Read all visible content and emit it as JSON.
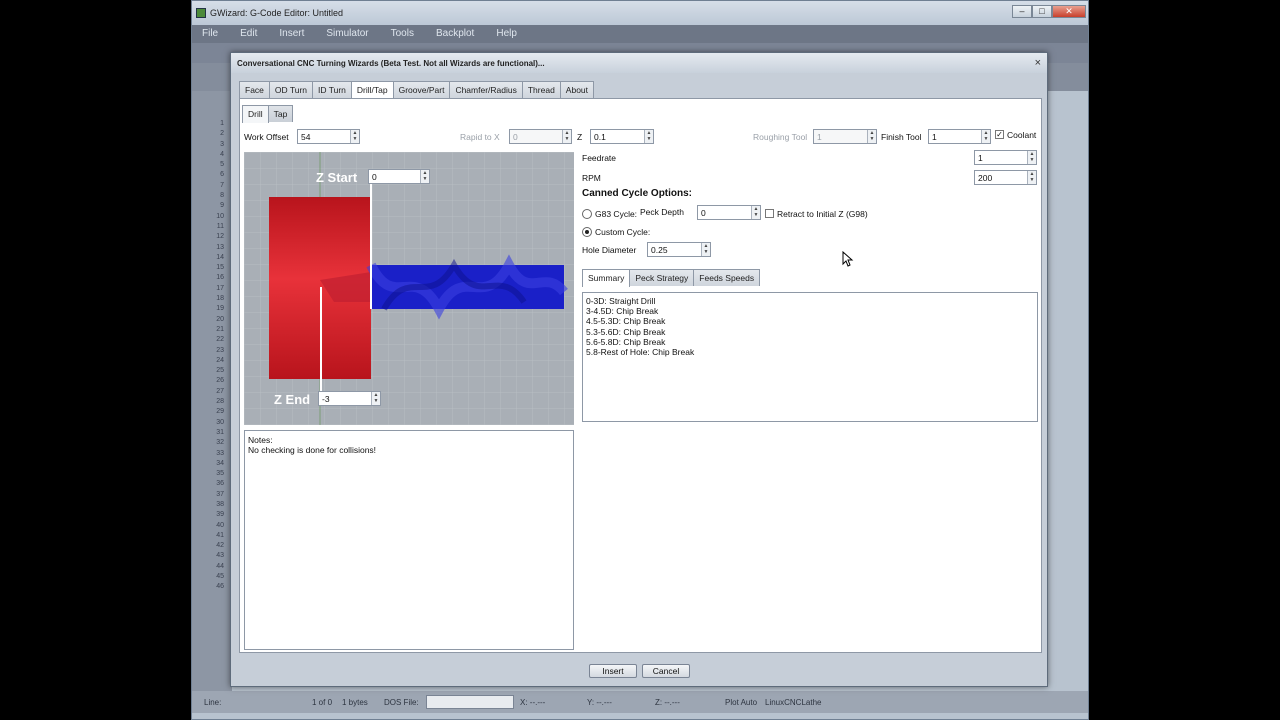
{
  "main_window": {
    "title": "GWizard: G-Code Editor: Untitled",
    "menu": [
      "File",
      "Edit",
      "Insert",
      "Simulator",
      "Tools",
      "Backplot",
      "Help"
    ],
    "line_numbers": [
      "1",
      "2",
      "3",
      "4",
      "5",
      "6",
      "7",
      "8",
      "9",
      "10",
      "11",
      "12",
      "13",
      "14",
      "15",
      "16",
      "17",
      "18",
      "19",
      "20",
      "21",
      "22",
      "23",
      "24",
      "25",
      "26",
      "27",
      "28",
      "29",
      "30",
      "31",
      "32",
      "33",
      "34",
      "35",
      "36",
      "37",
      "38",
      "39",
      "40",
      "41",
      "42",
      "43",
      "44",
      "45",
      "46"
    ],
    "status": {
      "line_label": "Line:",
      "count": "1 of 0",
      "bytes": "1 bytes",
      "dos_file_label": "DOS File:",
      "x": "X: --.---",
      "y": "Y: --.---",
      "z": "Z: --.---",
      "plot": "Plot Auto",
      "machine": "LinuxCNCLathe"
    }
  },
  "dialog": {
    "title": "Conversational CNC Turning Wizards (Beta Test.  Not all Wizards are functional)...",
    "close": "×",
    "tabs": [
      "Face",
      "OD Turn",
      "ID Turn",
      "Drill/Tap",
      "Groove/Part",
      "Chamfer/Radius",
      "Thread",
      "About"
    ],
    "active_tab": "Drill/Tap",
    "subtabs": [
      "Drill",
      "Tap"
    ],
    "active_subtab": "Drill",
    "fields": {
      "work_offset_label": "Work Offset",
      "work_offset": "54",
      "rapid_to_x_label": "Rapid to X",
      "rapid_to_x": "0",
      "z_label": "Z",
      "z": "0.1",
      "roughing_tool_label": "Roughing Tool",
      "roughing_tool": "1",
      "finish_tool_label": "Finish Tool",
      "finish_tool": "1",
      "coolant_label": "Coolant",
      "coolant_checked": true,
      "feedrate_label": "Feedrate",
      "feedrate": "1",
      "rpm_label": "RPM",
      "rpm": "200"
    },
    "canned": {
      "heading": "Canned Cycle Options:",
      "g83_label": "G83 Cycle:",
      "peck_depth_label": "Peck Depth",
      "peck_depth": "0",
      "retract_label": "Retract to Initial Z (G98)",
      "custom_label": "Custom Cycle:",
      "selected": "custom",
      "hole_diameter_label": "Hole Diameter",
      "hole_diameter": "0.25"
    },
    "diagram": {
      "z_start_label": "Z Start",
      "z_start": "0",
      "z_end_label": "Z End",
      "z_end": "-3",
      "colors": {
        "stock": "#d8202a",
        "drill": "#1a1fcc",
        "background": "#a9afb6"
      }
    },
    "notes": [
      "Notes:",
      "No checking is done for collisions!"
    ],
    "result_tabs": [
      "Summary",
      "Peck Strategy",
      "Feeds Speeds"
    ],
    "active_result_tab": "Summary",
    "summary_lines": [
      "0-3D: Straight Drill",
      "3-4.5D: Chip Break",
      "4.5-5.3D: Chip Break",
      "5.3-5.6D: Chip Break",
      "5.6-5.8D: Chip Break",
      "5.8-Rest of Hole: Chip Break"
    ],
    "buttons": {
      "insert": "Insert",
      "cancel": "Cancel"
    }
  }
}
